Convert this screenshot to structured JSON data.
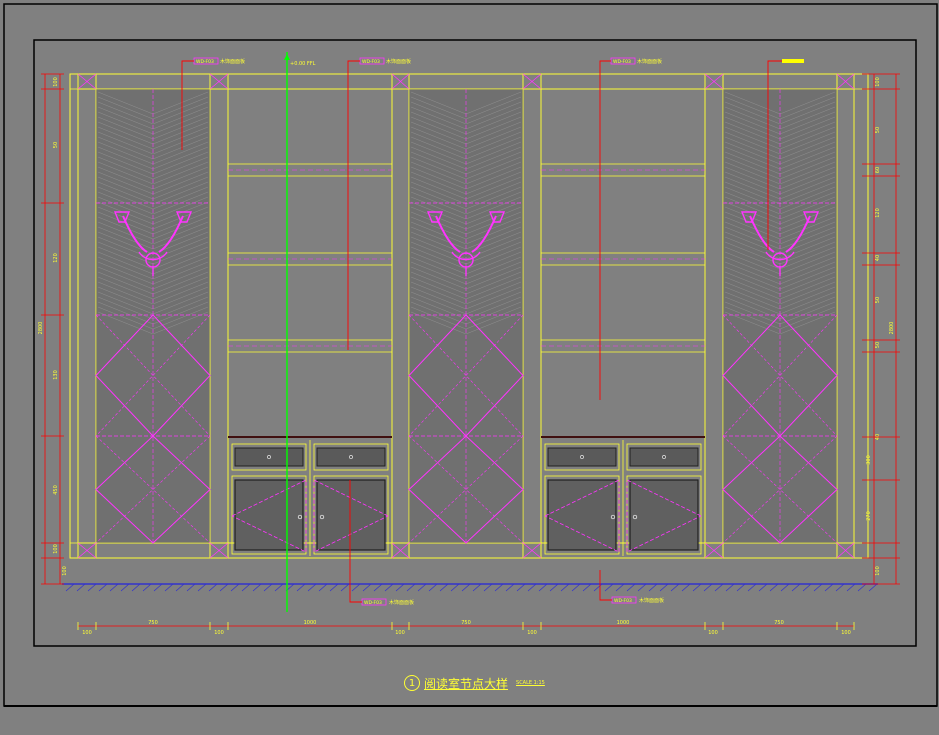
{
  "colors": {
    "background": "#808080",
    "frame": "#000000",
    "outline": "#ffff33",
    "pattern": "#ff33ff",
    "leader": "#ff0000",
    "axis": "#00ff00",
    "floor": "#3333cc",
    "handle": "#ffffff"
  },
  "title": {
    "number": "1",
    "text": "阅读室节点大样",
    "scale": "SCALE 1:15"
  },
  "callouts": {
    "top": [
      {
        "code": "WD-F03",
        "text": "木饰面面板"
      },
      {
        "code": "WD-F03",
        "text": "木饰面面板"
      },
      {
        "code": "WD-F03",
        "text": "木饰面面板"
      }
    ],
    "elevation": "+0.00 FFL",
    "bottom": [
      {
        "code": "WD-F03",
        "text": "木饰面面板"
      },
      {
        "code": "WD-F03",
        "text": "木饰面面板"
      }
    ]
  },
  "dimensions": {
    "bottom": [
      "100",
      "750",
      "100",
      "1000",
      "100",
      "750",
      "100",
      "1000",
      "100",
      "750",
      "100"
    ],
    "left": [
      "100",
      "50",
      "120",
      "130",
      "450",
      "100",
      "100"
    ],
    "left_total": "2800",
    "right": [
      "100",
      "50",
      "60",
      "120",
      "40",
      "50",
      "50",
      "40",
      "300",
      "270",
      "100"
    ],
    "right_total": "2800"
  }
}
